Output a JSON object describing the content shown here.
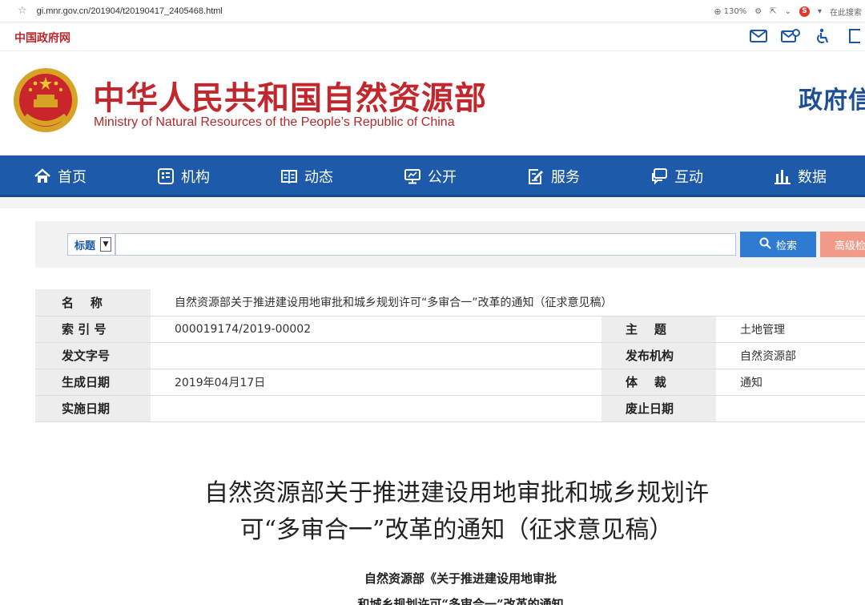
{
  "browser": {
    "url": "gi.mnr.gov.cn/201904/t20190417_2405468.html",
    "zoom": "130%",
    "search_hint": "在此搜索"
  },
  "gov_strip": {
    "gov_link": "中国政府网",
    "icons": [
      "mail-icon",
      "mail-settings-icon",
      "accessibility-icon",
      "language-icon"
    ]
  },
  "header": {
    "title_cn": "中华人民共和国自然资源部",
    "title_en": "Ministry of Natural Resources of the People’s Republic of China",
    "right_title": "政府信"
  },
  "nav": {
    "items": [
      {
        "label": "首页",
        "icon": "home-icon"
      },
      {
        "label": "机构",
        "icon": "org-icon"
      },
      {
        "label": "动态",
        "icon": "book-icon"
      },
      {
        "label": "公开",
        "icon": "monitor-icon"
      },
      {
        "label": "服务",
        "icon": "edit-icon"
      },
      {
        "label": "互动",
        "icon": "chat-icon"
      },
      {
        "label": "数据",
        "icon": "bar-chart-icon"
      }
    ]
  },
  "search": {
    "field_select": "标题",
    "input_value": "",
    "search_label": "检索",
    "advanced_label": "高级检"
  },
  "meta": {
    "name_label": "名    称",
    "name_value": "自然资源部关于推进建设用地审批和城乡规划许可“多审合一”改革的通知（征求意见稿）",
    "index_label": "索 引 号",
    "index_value": "000019174/2019-00002",
    "subject_label": "主    题",
    "subject_value": "土地管理",
    "docno_label": "发文字号",
    "docno_value": "",
    "issuer_label": "发布机构",
    "issuer_value": "自然资源部",
    "date_label": "生成日期",
    "date_value": "2019年04月17日",
    "genre_label": "体    裁",
    "genre_value": "通知",
    "effective_label": "实施日期",
    "effective_value": "",
    "expiry_label": "废止日期",
    "expiry_value": ""
  },
  "article": {
    "title_line1": "自然资源部关于推进建设用地审批和城乡规划许",
    "title_line2": "可“多审合一”改革的通知（征求意见稿）",
    "sub_line1": "自然资源部《关于推进建设用地审批",
    "sub_line2": "和城乡规划许可“多审合一”改革的通知"
  },
  "colors": {
    "brand_red": "#c1272d",
    "nav_blue": "#1d5aa9",
    "search_blue": "#2f7bd1",
    "advanced_salmon": "#f29a88"
  }
}
